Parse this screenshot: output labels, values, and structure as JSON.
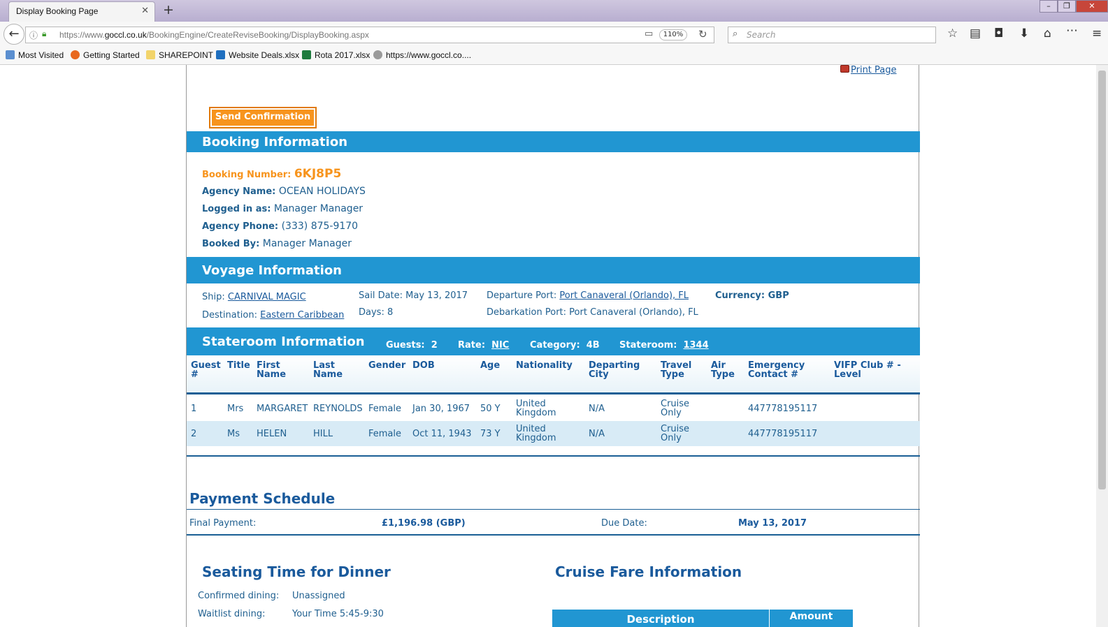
{
  "browser": {
    "tab_title": "Display Booking Page",
    "url_prefix": "https://www.",
    "url_domain": "goccl.co.uk",
    "url_path": "/BookingEngine/CreateReviseBooking/DisplayBooking.aspx",
    "zoom": "110%",
    "search_placeholder": "Search",
    "bookmarks": [
      "Most Visited",
      "Getting Started",
      "SHAREPOINT",
      "Website Deals.xlsx",
      "Rota 2017.xlsx",
      "https://www.goccl.co...."
    ]
  },
  "page": {
    "print_label": "Print Page",
    "send_confirmation_label": "Send Confirmation"
  },
  "booking": {
    "title": "Booking Information",
    "number_label": "Booking Number:",
    "number": "6KJ8P5",
    "agency_name_label": "Agency Name:",
    "agency_name": "OCEAN HOLIDAYS",
    "logged_in_label": "Logged in as:",
    "logged_in": "Manager Manager",
    "agency_phone_label": "Agency Phone:",
    "agency_phone": "(333) 875-9170",
    "booked_by_label": "Booked By:",
    "booked_by": "Manager Manager"
  },
  "voyage": {
    "title": "Voyage Information",
    "ship_label": "Ship:",
    "ship": "CARNIVAL MAGIC",
    "destination_label": "Destination:",
    "destination": "Eastern Caribbean",
    "sail_date_label": "Sail Date:",
    "sail_date": "May 13, 2017",
    "days_label": "Days:",
    "days": "8",
    "departure_port_label": "Departure Port:",
    "departure_port": "Port Canaveral (Orlando), FL",
    "debarkation_port_label": "Debarkation Port:",
    "debarkation_port": "Port Canaveral (Orlando), FL",
    "currency_label": "Currency:",
    "currency": "GBP"
  },
  "stateroom": {
    "title": "Stateroom Information",
    "guests_label": "Guests:",
    "guests": "2",
    "rate_label": "Rate:",
    "rate": "NIC",
    "category_label": "Category:",
    "category": "4B",
    "stateroom_label": "Stateroom:",
    "stateroom": "1344"
  },
  "guests": {
    "headers": {
      "guest_1": "Guest",
      "guest_2": "#",
      "title": "Title",
      "first_1": "First",
      "first_2": "Name",
      "last_1": "Last",
      "last_2": "Name",
      "gender": "Gender",
      "dob": "DOB",
      "age": "Age",
      "nationality": "Nationality",
      "dep_1": "Departing",
      "dep_2": "City",
      "travel_1": "Travel",
      "travel_2": "Type",
      "air_1": "Air",
      "air_2": "Type",
      "emerg_1": "Emergency",
      "emerg_2": "Contact #",
      "vifp_1": "VIFP Club # -",
      "vifp_2": "Level"
    },
    "rows": [
      {
        "num": "1",
        "title": "Mrs",
        "first": "MARGARET",
        "last": "REYNOLDS",
        "gender": "Female",
        "dob": "Jan 30, 1967",
        "age": "50 Y",
        "nat_1": "United",
        "nat_2": "Kingdom",
        "city": "N/A",
        "travel_1": "Cruise",
        "travel_2": "Only",
        "contact": "447778195117"
      },
      {
        "num": "2",
        "title": "Ms",
        "first": "HELEN",
        "last": "HILL",
        "gender": "Female",
        "dob": "Oct 11, 1943",
        "age": "73 Y",
        "nat_1": "United",
        "nat_2": "Kingdom",
        "city": "N/A",
        "travel_1": "Cruise",
        "travel_2": "Only",
        "contact": "447778195117"
      }
    ]
  },
  "payment": {
    "title": "Payment Schedule",
    "final_label": "Final Payment:",
    "final_amount": "£1,196.98 (GBP)",
    "due_label": "Due Date:",
    "due_date": "May 13, 2017"
  },
  "dining": {
    "title": "Seating Time for Dinner",
    "confirmed_label": "Confirmed dining:",
    "confirmed": "Unassigned",
    "waitlist_label": "Waitlist dining:",
    "waitlist": "Your Time 5:45-9:30"
  },
  "fare": {
    "title": "Cruise Fare Information",
    "col_description": "Description",
    "col_amount": "Amount"
  },
  "colors": {
    "header_blue": "#2196d2",
    "accent_orange": "#f7941d",
    "text_blue": "#1f5f8f"
  }
}
